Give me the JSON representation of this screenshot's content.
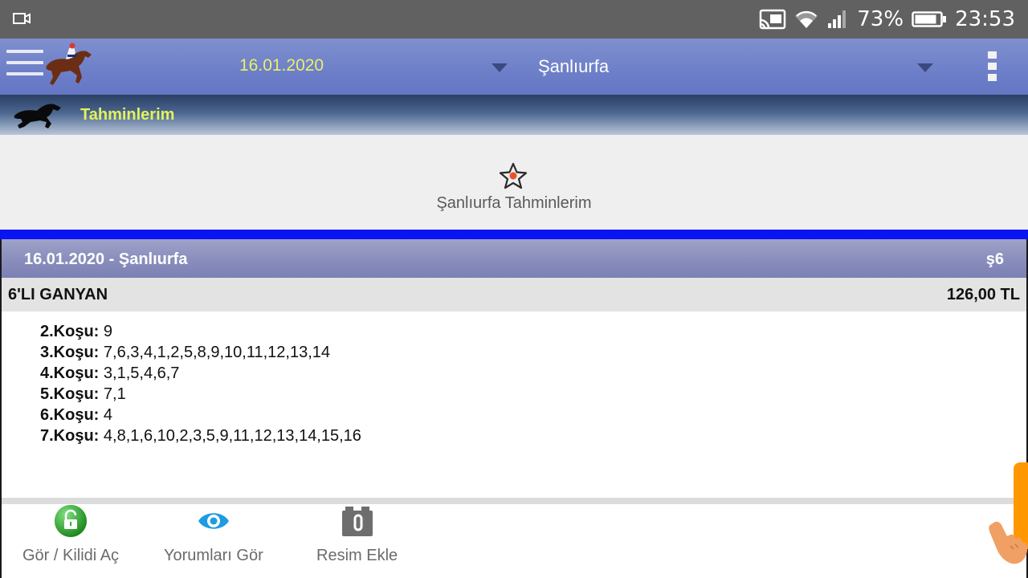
{
  "status_bar": {
    "battery": "73%",
    "time": "23:53"
  },
  "app_bar": {
    "date": "16.01.2020",
    "city": "Şanlıurfa"
  },
  "section": {
    "title": "Tahminlerim"
  },
  "favorites": {
    "label": "Şanlıurfa Tahminlerim"
  },
  "card": {
    "title": "16.01.2020 - Şanlıurfa",
    "code": "ş6",
    "bet_type": "6'LI GANYAN",
    "amount": "126,00 TL",
    "races": [
      {
        "label": "2.Koşu:",
        "value": " 9"
      },
      {
        "label": "3.Koşu:",
        "value": " 7,6,3,4,1,2,5,8,9,10,11,12,13,14"
      },
      {
        "label": "4.Koşu:",
        "value": " 3,1,5,4,6,7"
      },
      {
        "label": "5.Koşu:",
        "value": " 7,1"
      },
      {
        "label": "6.Koşu:",
        "value": " 4"
      },
      {
        "label": "7.Koşu:",
        "value": " 4,8,1,6,10,2,3,5,9,11,12,13,14,15,16"
      }
    ]
  },
  "actions": {
    "unlock": "Gör / Kilidi Aç",
    "comments": "Yorumları Gör",
    "add_image": "Resim Ekle"
  },
  "colors": {
    "accent_blue": "#0a14f2",
    "date_yellow": "#e8ef6a",
    "edge_tab": "#ff9800"
  }
}
